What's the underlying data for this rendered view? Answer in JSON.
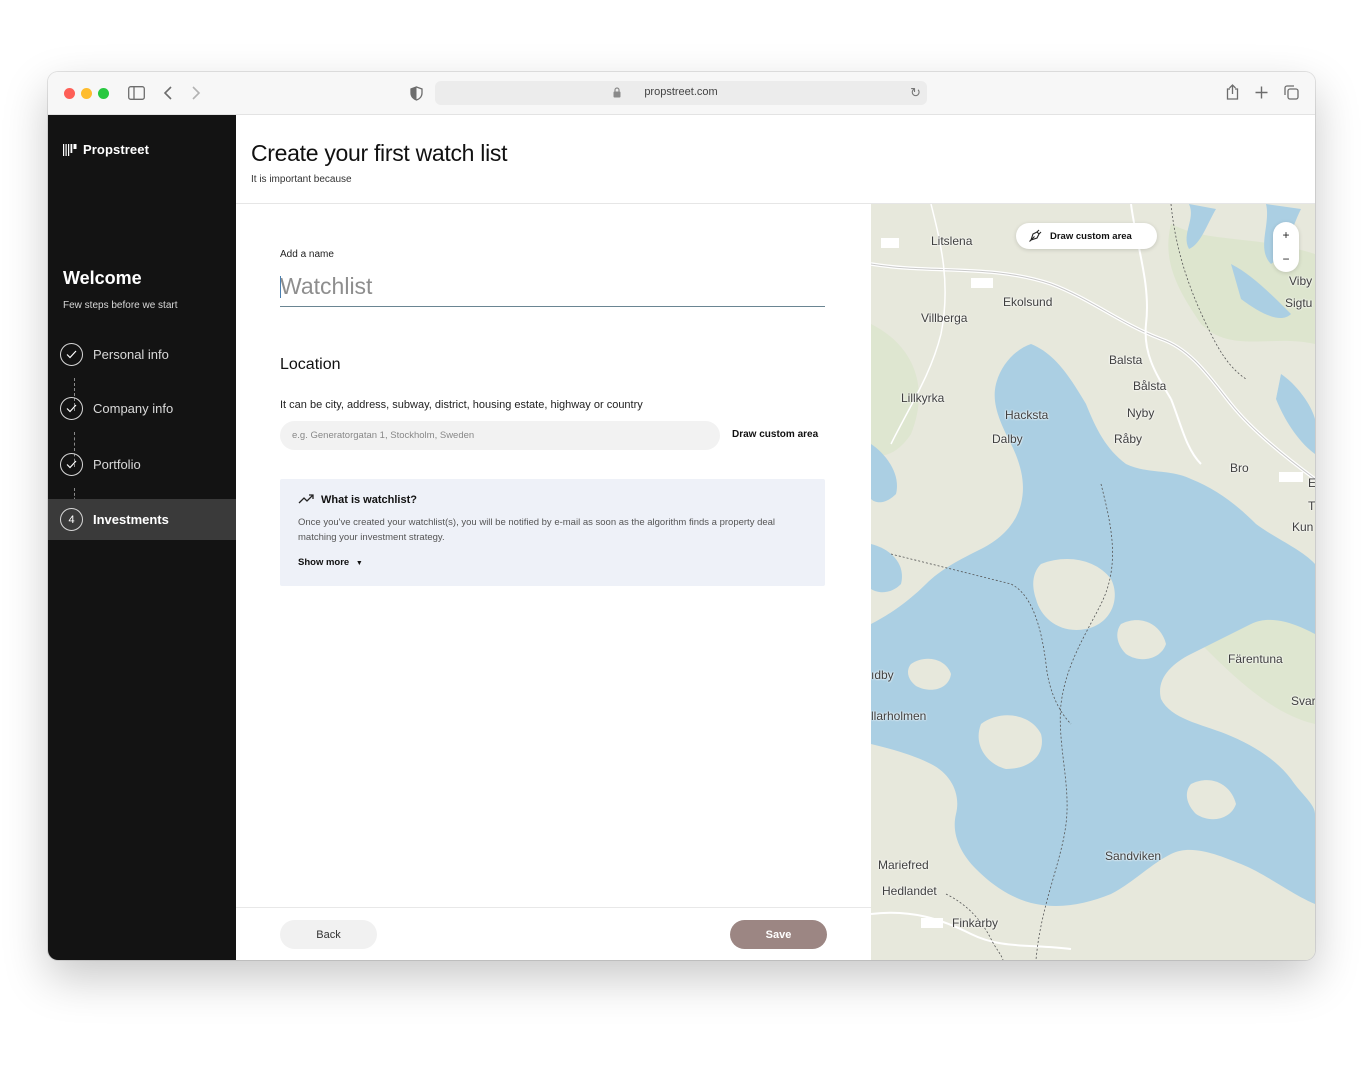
{
  "browser": {
    "url": "propstreet.com"
  },
  "sidebar": {
    "brand": "Propstreet",
    "welcome_title": "Welcome",
    "welcome_subtitle": "Few steps before we start",
    "steps": [
      {
        "label": "Personal info",
        "marker": "",
        "state": "completed"
      },
      {
        "label": "Company info",
        "marker": "",
        "state": "completed"
      },
      {
        "label": "Portfolio",
        "marker": "",
        "state": "completed"
      },
      {
        "label": "Investments",
        "marker": "4",
        "state": "active"
      }
    ]
  },
  "header": {
    "title": "Create your first watch list",
    "subtitle": "It is important because"
  },
  "form": {
    "name_label": "Add a name",
    "name_value": "",
    "name_placeholder": "Watchlist",
    "location_title": "Location",
    "location_help": "It can be city, address, subway, district, housing estate, highway or country",
    "location_value": "",
    "location_placeholder": "e.g. Generatorgatan 1, Stockholm, Sweden",
    "draw_custom_area": "Draw custom area",
    "info": {
      "title": "What is watchlist?",
      "body": "Once you've created your watchlist(s), you will be notified by e-mail as soon as the algorithm finds a property deal matching your investment strategy.",
      "show_more": "Show more"
    },
    "back_label": "Back",
    "save_label": "Save"
  },
  "map": {
    "draw_button": "Draw custom area",
    "zoom_in": "+",
    "zoom_out": "−",
    "places": [
      "Litslena",
      "Ekolsund",
      "Villberga",
      "Viby",
      "Sigtu",
      "Balsta",
      "Bålsta",
      "Lillkyrka",
      "Hacksta",
      "Nyby",
      "Dalby",
      "Råby",
      "Bro",
      "E",
      "T",
      "Kun",
      "Färentuna",
      "ıdby",
      "Svar",
      "llarholmen",
      "Sandviken",
      "Mariefred",
      "Hedlandet",
      "Finkarby"
    ]
  },
  "colors": {
    "sidebar_bg": "#131313",
    "save_button": "#9c8683",
    "info_bg": "#eef1f8",
    "water": "#abcfe3",
    "land": "#e7e8dc"
  }
}
